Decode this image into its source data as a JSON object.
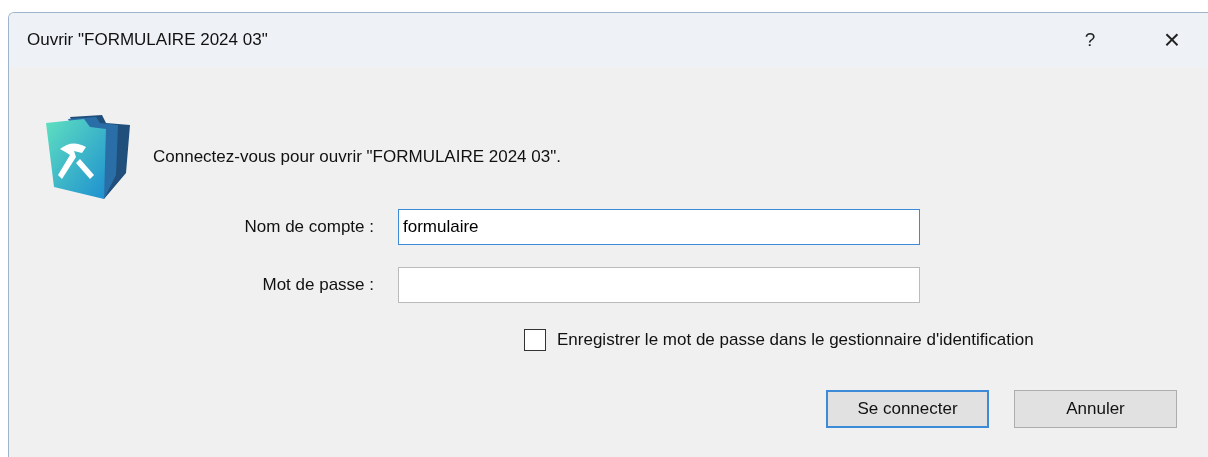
{
  "window": {
    "title": "Ouvrir \"FORMULAIRE 2024 03\"",
    "help": "?",
    "close": "×"
  },
  "message": "Connectez-vous pour ouvrir \"FORMULAIRE 2024 03\".",
  "fields": [
    {
      "label": "Nom de compte :",
      "value": "formulaire",
      "focused": true
    },
    {
      "label": "Mot de passe :",
      "focused": false
    }
  ],
  "remember": {
    "label": "Enregistrer le mot de passe dans le gestionnaire d'identification",
    "checked": false
  },
  "buttons": [
    {
      "label": "Se connecter",
      "default": true
    },
    {
      "label": "Annuler",
      "default": false
    }
  ]
}
